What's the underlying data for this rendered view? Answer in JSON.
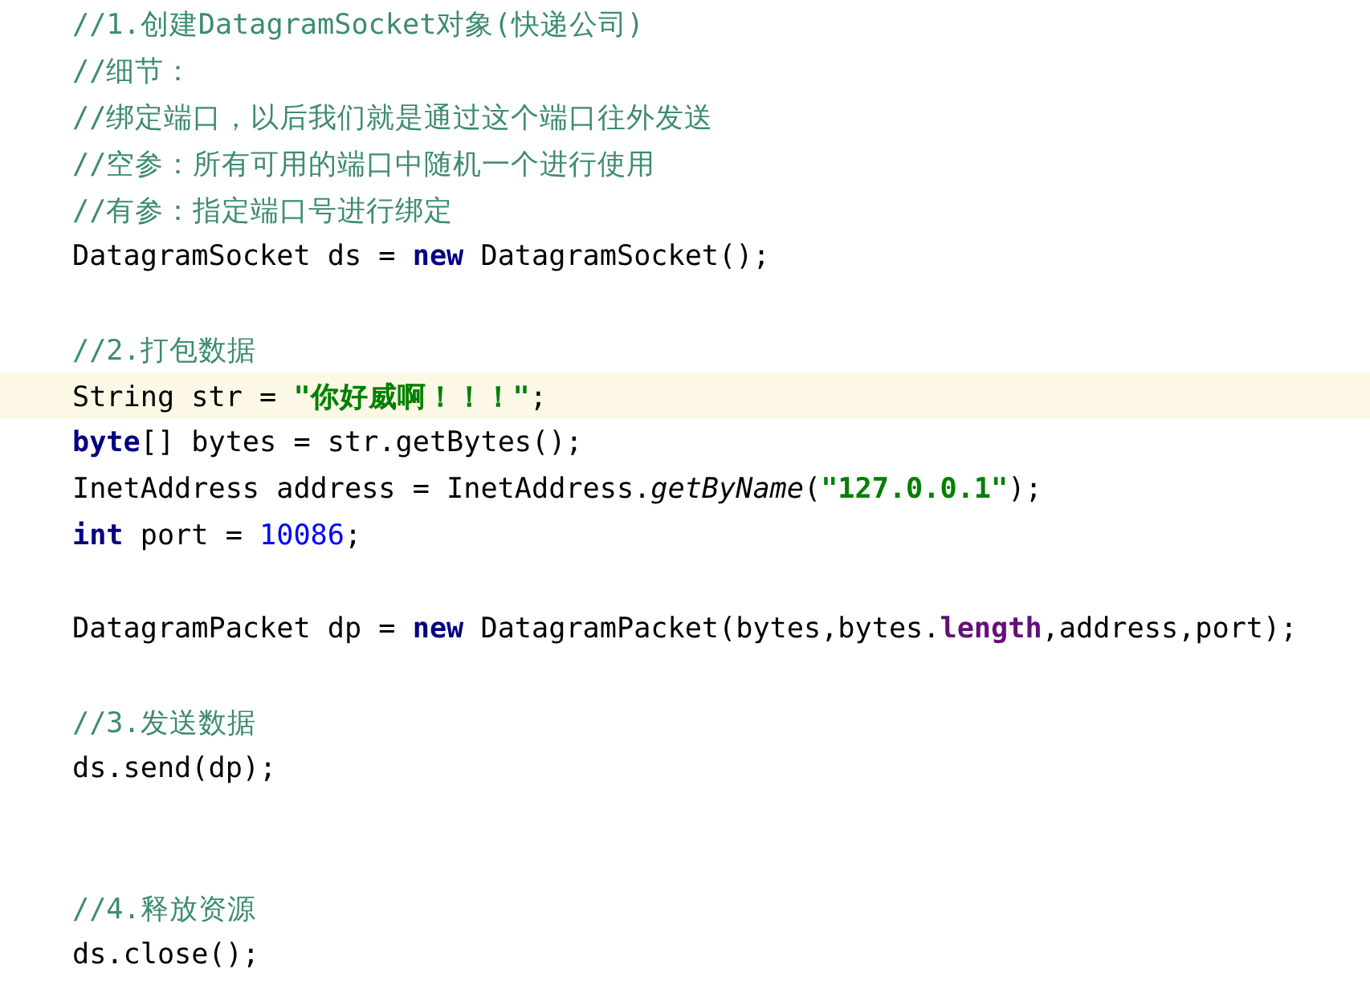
{
  "editor": {
    "lines": [
      {
        "kind": "code",
        "highlighted": false,
        "tokens": [
          {
            "kind": "comment",
            "text": "//1.创建DatagramSocket对象(快递公司)"
          }
        ]
      },
      {
        "kind": "code",
        "highlighted": false,
        "tokens": [
          {
            "kind": "comment",
            "text": "//细节："
          }
        ]
      },
      {
        "kind": "code",
        "highlighted": false,
        "tokens": [
          {
            "kind": "comment",
            "text": "//绑定端口，以后我们就是通过这个端口往外发送"
          }
        ]
      },
      {
        "kind": "code",
        "highlighted": false,
        "tokens": [
          {
            "kind": "comment",
            "text": "//空参：所有可用的端口中随机一个进行使用"
          }
        ]
      },
      {
        "kind": "code",
        "highlighted": false,
        "tokens": [
          {
            "kind": "comment",
            "text": "//有参：指定端口号进行绑定"
          }
        ]
      },
      {
        "kind": "code",
        "highlighted": false,
        "tokens": [
          {
            "kind": "plain",
            "text": "DatagramSocket ds = "
          },
          {
            "kind": "keyword",
            "text": "new"
          },
          {
            "kind": "plain",
            "text": " DatagramSocket();"
          }
        ]
      },
      {
        "kind": "blank"
      },
      {
        "kind": "code",
        "highlighted": false,
        "tokens": [
          {
            "kind": "comment",
            "text": "//2.打包数据"
          }
        ]
      },
      {
        "kind": "code",
        "highlighted": true,
        "tokens": [
          {
            "kind": "plain",
            "text": "String str = "
          },
          {
            "kind": "string",
            "text": "\"你好威啊！！！\""
          },
          {
            "kind": "plain",
            "text": ";"
          }
        ]
      },
      {
        "kind": "code",
        "highlighted": false,
        "tokens": [
          {
            "kind": "keyword",
            "text": "byte"
          },
          {
            "kind": "plain",
            "text": "[] bytes = str.getBytes();"
          }
        ]
      },
      {
        "kind": "code",
        "highlighted": false,
        "tokens": [
          {
            "kind": "plain",
            "text": "InetAddress address = InetAddress."
          },
          {
            "kind": "method",
            "text": "getByName"
          },
          {
            "kind": "plain",
            "text": "("
          },
          {
            "kind": "string",
            "text": "\"127.0.0.1\""
          },
          {
            "kind": "plain",
            "text": ");"
          }
        ]
      },
      {
        "kind": "code",
        "highlighted": false,
        "tokens": [
          {
            "kind": "keyword",
            "text": "int"
          },
          {
            "kind": "plain",
            "text": " port = "
          },
          {
            "kind": "number",
            "text": "10086"
          },
          {
            "kind": "plain",
            "text": ";"
          }
        ]
      },
      {
        "kind": "blank"
      },
      {
        "kind": "code",
        "highlighted": false,
        "tokens": [
          {
            "kind": "plain",
            "text": "DatagramPacket dp = "
          },
          {
            "kind": "keyword",
            "text": "new"
          },
          {
            "kind": "plain",
            "text": " DatagramPacket(bytes,bytes."
          },
          {
            "kind": "field",
            "text": "length"
          },
          {
            "kind": "plain",
            "text": ",address,port);"
          }
        ]
      },
      {
        "kind": "blank"
      },
      {
        "kind": "code",
        "highlighted": false,
        "tokens": [
          {
            "kind": "comment",
            "text": "//3.发送数据"
          }
        ]
      },
      {
        "kind": "code",
        "highlighted": false,
        "tokens": [
          {
            "kind": "plain",
            "text": "ds.send(dp);"
          }
        ]
      },
      {
        "kind": "blank"
      },
      {
        "kind": "blank"
      },
      {
        "kind": "code",
        "highlighted": false,
        "tokens": [
          {
            "kind": "comment",
            "text": "//4.释放资源"
          }
        ]
      },
      {
        "kind": "code",
        "highlighted": false,
        "tokens": [
          {
            "kind": "plain",
            "text": "ds.close();"
          }
        ]
      }
    ]
  }
}
